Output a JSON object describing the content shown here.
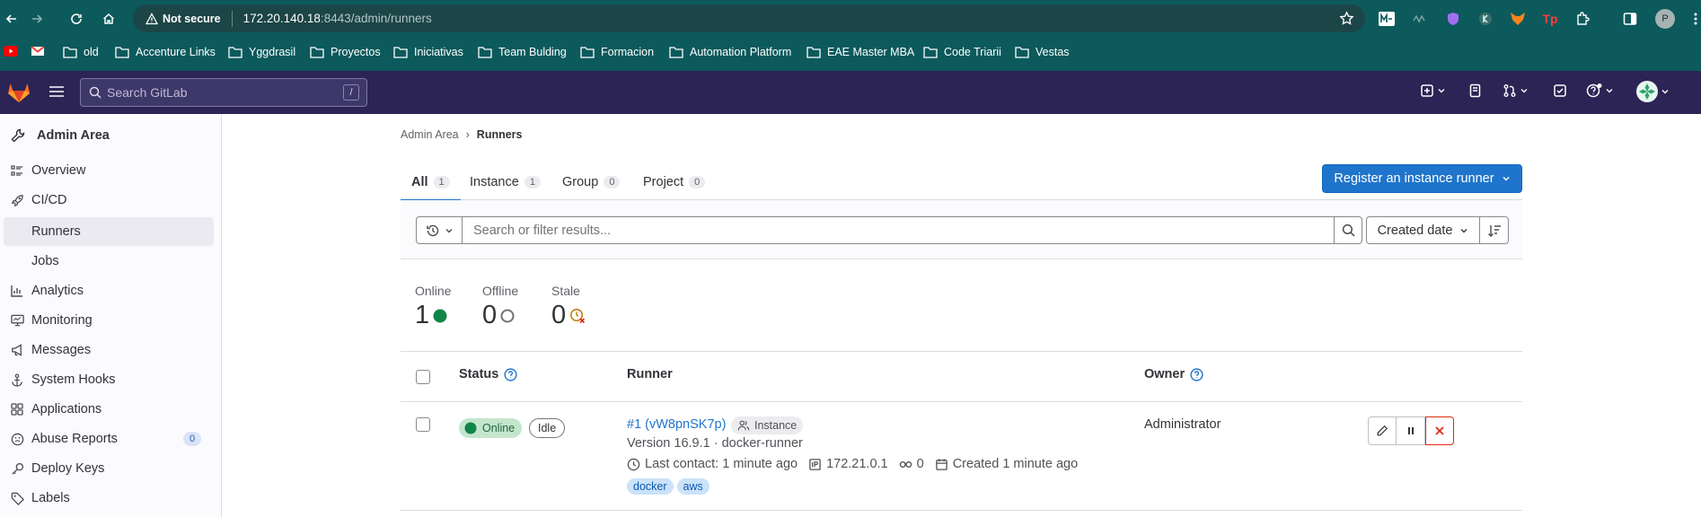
{
  "browser": {
    "not_secure_label": "Not secure",
    "url_host": "172.20.140.18",
    "url_rest": ":8443/admin/runners",
    "profile_initial": "P",
    "ext_tp": "Tp"
  },
  "bookmarks": [
    {
      "label": "old"
    },
    {
      "label": "Accenture Links"
    },
    {
      "label": "Yggdrasil"
    },
    {
      "label": "Proyectos"
    },
    {
      "label": "Iniciativas"
    },
    {
      "label": "Team Bulding"
    },
    {
      "label": "Formacion"
    },
    {
      "label": "Automation Platform"
    },
    {
      "label": "EAE Master MBA"
    },
    {
      "label": "Code Triarii"
    },
    {
      "label": "Vestas"
    }
  ],
  "header": {
    "search_placeholder": "Search GitLab",
    "search_shortcut": "/"
  },
  "sidebar": {
    "title": "Admin Area",
    "items": [
      {
        "label": "Overview",
        "icon": "overview-icon"
      },
      {
        "label": "CI/CD",
        "icon": "rocket-icon"
      },
      {
        "label": "Runners",
        "icon": "",
        "sub": true,
        "active": true
      },
      {
        "label": "Jobs",
        "icon": "",
        "sub": true
      },
      {
        "label": "Analytics",
        "icon": "chart-icon"
      },
      {
        "label": "Monitoring",
        "icon": "monitor-icon"
      },
      {
        "label": "Messages",
        "icon": "bullhorn-icon"
      },
      {
        "label": "System Hooks",
        "icon": "anchor-icon"
      },
      {
        "label": "Applications",
        "icon": "apps-icon"
      },
      {
        "label": "Abuse Reports",
        "icon": "abuse-icon",
        "badge": "0"
      },
      {
        "label": "Deploy Keys",
        "icon": "key-icon"
      },
      {
        "label": "Labels",
        "icon": "label-icon"
      }
    ]
  },
  "breadcrumb": {
    "parent": "Admin Area",
    "separator": "›",
    "current": "Runners"
  },
  "tabs": [
    {
      "label": "All",
      "count": "1",
      "active": true
    },
    {
      "label": "Instance",
      "count": "1"
    },
    {
      "label": "Group",
      "count": "0"
    },
    {
      "label": "Project",
      "count": "0"
    }
  ],
  "register_button": "Register an instance runner",
  "filter": {
    "placeholder": "Search or filter results...",
    "sort_label": "Created date"
  },
  "stats": {
    "online": {
      "label": "Online",
      "value": "1"
    },
    "offline": {
      "label": "Offline",
      "value": "0"
    },
    "stale": {
      "label": "Stale",
      "value": "0"
    }
  },
  "table": {
    "headers": {
      "status": "Status",
      "runner": "Runner",
      "owner": "Owner"
    },
    "rows": [
      {
        "status": "Online",
        "state": "Idle",
        "runner_link": "#1 (vW8pnSK7p)",
        "runner_type": "Instance",
        "version": "Version 16.9.1 · docker-runner",
        "last_contact": "Last contact: 1 minute ago",
        "ip": "172.21.0.1",
        "jobs": "0",
        "created": "Created 1 minute ago",
        "tags": [
          "docker",
          "aws"
        ],
        "owner": "Administrator"
      }
    ]
  },
  "colors": {
    "browser_bar": "#0c5a5c",
    "gitlab_header": "#2b2454",
    "primary": "#1f75cb",
    "online": "#108548",
    "danger": "#dd2b0e"
  }
}
